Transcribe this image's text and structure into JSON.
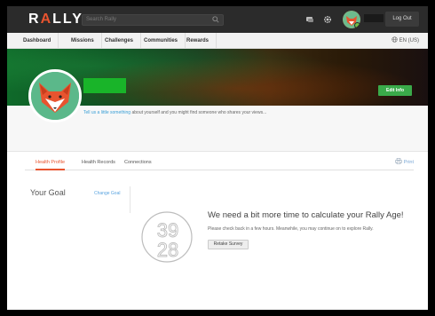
{
  "header": {
    "logo_prefix": "R",
    "logo_accent": "A",
    "logo_suffix": "LLY",
    "search_placeholder": "Search Rally",
    "logout_label": "Log Out"
  },
  "nav": {
    "items": [
      {
        "label": "Dashboard"
      },
      {
        "label": "Missions"
      },
      {
        "label": "Challenges"
      },
      {
        "label": "Communities"
      },
      {
        "label": "Rewards"
      }
    ],
    "language": "EN (US)"
  },
  "profile": {
    "edit_label": "Edit Info",
    "about_link": "Tell us a little something",
    "about_rest": " about yourself and you might find someone who shares your views..."
  },
  "tabs": {
    "items": [
      {
        "label": "Health Profile",
        "active": true
      },
      {
        "label": "Health Records",
        "active": false
      },
      {
        "label": "Connections",
        "active": false
      }
    ],
    "print_label": "Print"
  },
  "goal": {
    "title": "Your Goal",
    "change_label": "Change Goal"
  },
  "age": {
    "digits_top": "39",
    "digits_bottom": "28",
    "title": "We need a bit more time to calculate your Rally Age!",
    "description": "Please check back in a few hours. Meanwhile, you may continue on to explore Rally.",
    "retake_label": "Retake Survey"
  },
  "colors": {
    "accent": "#e8542f",
    "green": "#3aaa4a",
    "link": "#3a9fd6"
  }
}
